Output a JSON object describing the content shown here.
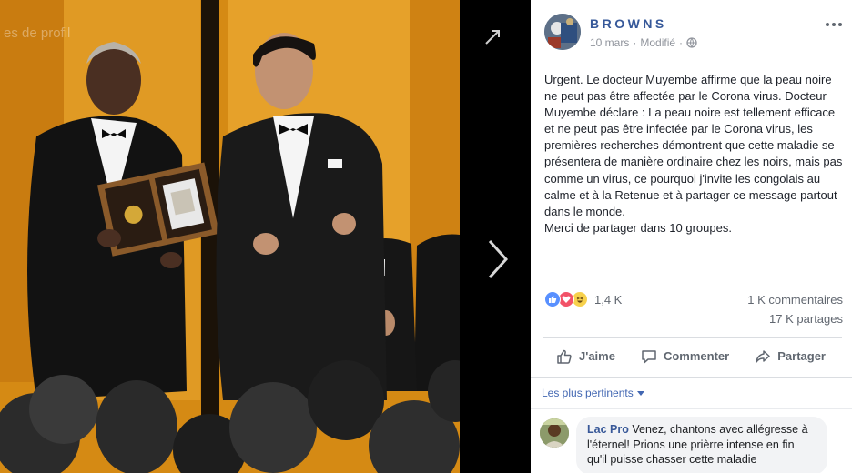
{
  "photo": {
    "watermark": "es de profil",
    "alt": "",
    "expand_icon": "expand-icon",
    "next_icon": "chevron-right-icon"
  },
  "post": {
    "page_name": "BROWNS",
    "date": "10 mars",
    "edited": "Modifié",
    "audience_icon": "globe-icon",
    "more_icon": "ellipsis-icon",
    "text": "Urgent. Le docteur Muyembe affirme que la peau noire ne peut pas être affectée par le Corona virus. Docteur Muyembe déclare : La peau noire est tellement efficace et ne peut pas être infectée par le Corona virus, les premières recherches démontrent que cette maladie se présentera de manière ordinaire chez les noirs, mais pas comme un virus, ce pourquoi j'invite les congolais au calme et à la Retenue et à partager ce message partout dans le monde.\nMerci de partager dans 10 groupes."
  },
  "stats": {
    "reactions": "1,4 K",
    "reaction_icons": [
      "like-icon",
      "love-icon",
      "haha-icon"
    ],
    "comments": "1 K commentaires",
    "shares": "17 K partages"
  },
  "actions": {
    "like": "J'aime",
    "comment": "Commenter",
    "share": "Partager"
  },
  "sort": {
    "label": "Les plus pertinents"
  },
  "comments": [
    {
      "author": "Lac Pro",
      "text": "Venez, chantons avec allégresse à l'éternel! Prions une prièrre intense en fin qu'il puisse chasser cette maladie"
    }
  ],
  "colors": {
    "link": "#365899",
    "accent": "#4267b2",
    "like": "#5890ff",
    "love": "#f25268",
    "haha": "#f7d14c"
  }
}
